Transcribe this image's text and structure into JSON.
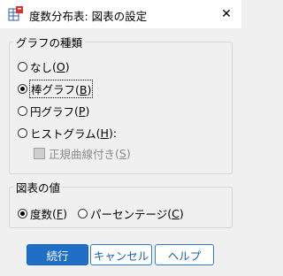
{
  "window": {
    "title": "度数分布表: 図表の設定",
    "close_glyph": "✕"
  },
  "chart_type_group": {
    "legend": "グラフの種類",
    "options": [
      {
        "label": "なし",
        "key": "O",
        "selected": false
      },
      {
        "label": "棒グラフ",
        "key": "B",
        "selected": true
      },
      {
        "label": "円グラフ",
        "key": "P",
        "selected": false
      },
      {
        "label": "ヒストグラム",
        "key": "H",
        "suffix": ":",
        "selected": false
      }
    ],
    "normal_curve": {
      "label": "正規曲線付き",
      "key": "S",
      "checked": false,
      "enabled": false
    }
  },
  "values_group": {
    "legend": "図表の値",
    "options": [
      {
        "label": "度数",
        "key": "F",
        "selected": true
      },
      {
        "label": "パーセンテージ",
        "key": "C",
        "selected": false
      }
    ]
  },
  "buttons": {
    "continue": "続行",
    "cancel": "キャンセル",
    "help": "ヘルプ"
  },
  "colors": {
    "primary": "#1f6fc6",
    "background": "#f0f0f0"
  },
  "icons": {
    "app": "spss-table-icon",
    "close": "close-icon"
  }
}
